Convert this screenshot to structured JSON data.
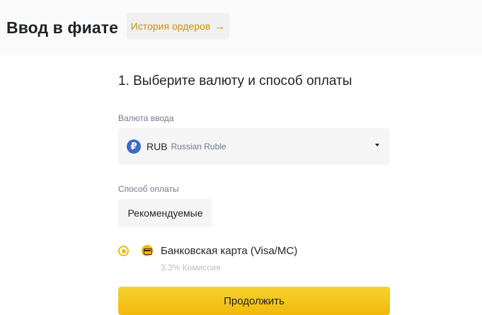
{
  "header": {
    "title": "Ввод в фиате",
    "history_button_label": "История ордеров",
    "history_button_arrow": "→"
  },
  "step": {
    "title": "1. Выберите валюту и способ оплаты"
  },
  "currency": {
    "label": "Валюта ввода",
    "icon_symbol": "₽",
    "code": "RUB",
    "name": "Russian Ruble"
  },
  "payment": {
    "label": "Способ оплаты",
    "tab_label": "Рекомендуемые",
    "method_name": "Банковская карта (Visa/MC)",
    "method_fee": "3.3% Комиссия",
    "selected": true
  },
  "actions": {
    "continue_label": "Продолжить"
  },
  "colors": {
    "accent": "#f0b90b",
    "accent_text": "#c99400",
    "rub_icon": "#3c6cc4"
  }
}
